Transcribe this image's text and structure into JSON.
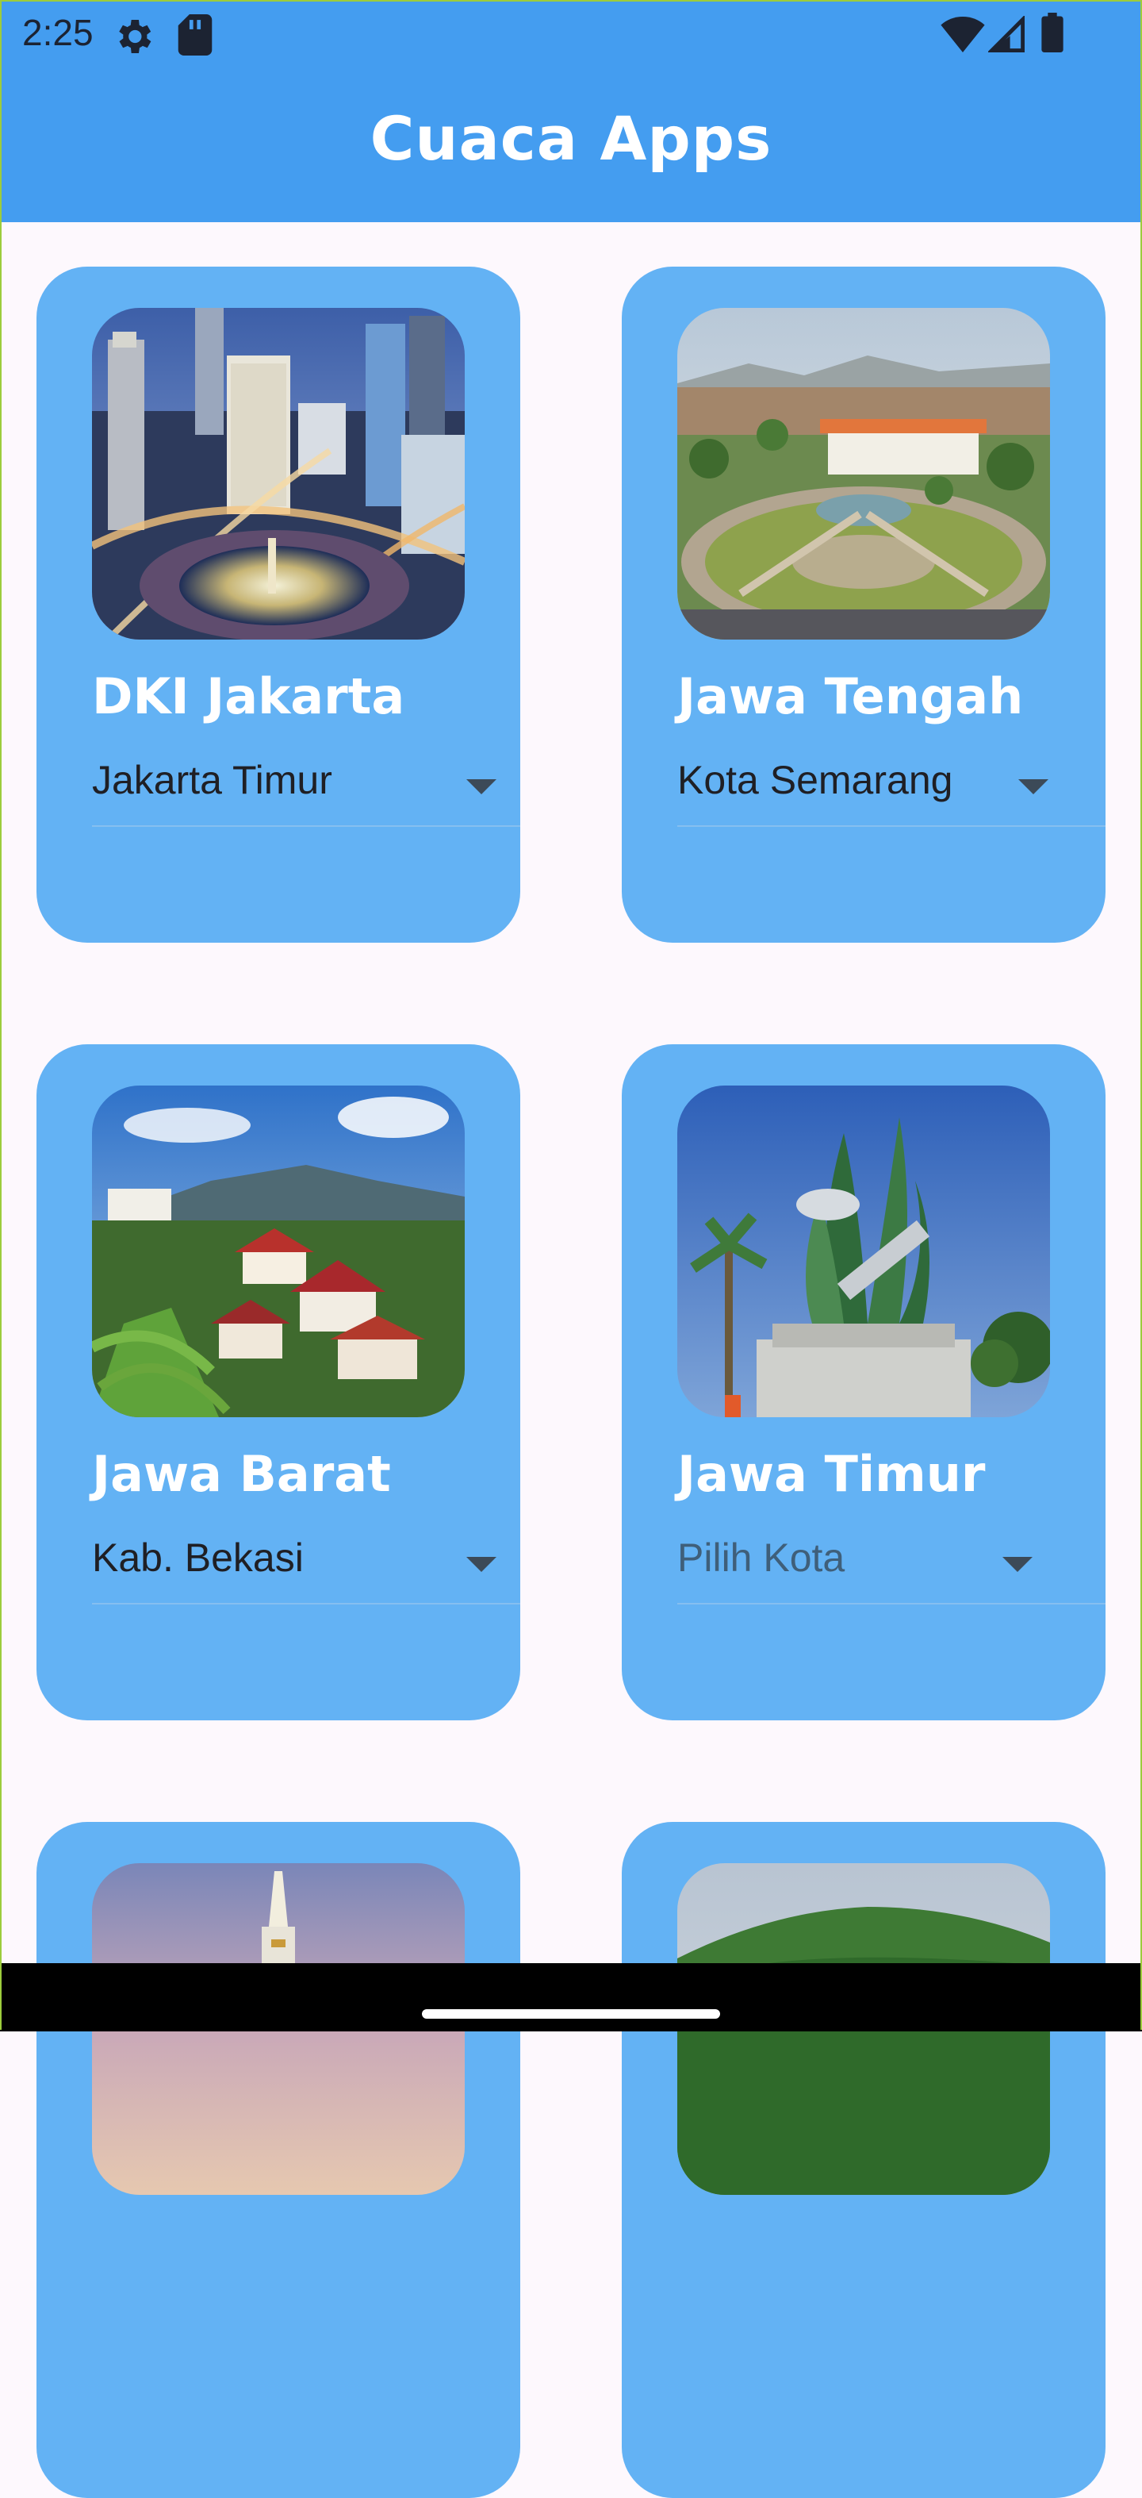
{
  "status_bar": {
    "time": "2:25",
    "icons": [
      "settings-gear-icon",
      "sd-card-icon",
      "wifi-icon",
      "cell-signal-icon",
      "battery-icon"
    ]
  },
  "app_bar": {
    "title": "Cuaca Apps",
    "color": "#449df0"
  },
  "cards": [
    {
      "province": "DKI Jakarta",
      "city": "Jakarta Timur",
      "image": "jakarta-roundabout-night-image"
    },
    {
      "province": "Jawa Tengah",
      "city": "Kota Semarang",
      "image": "semarang-city-aerial-image"
    },
    {
      "province": "Jawa Barat",
      "city": "Kab. Bekasi",
      "image": "west-java-mountain-village-image"
    },
    {
      "province": "Jawa Timur",
      "city_placeholder": "Pilih Kota",
      "image": "surabaya-shark-crocodile-statue-image"
    }
  ],
  "colors": {
    "card": "#63b2f4",
    "background": "#fdf8fd",
    "title_text": "#ffffff"
  }
}
